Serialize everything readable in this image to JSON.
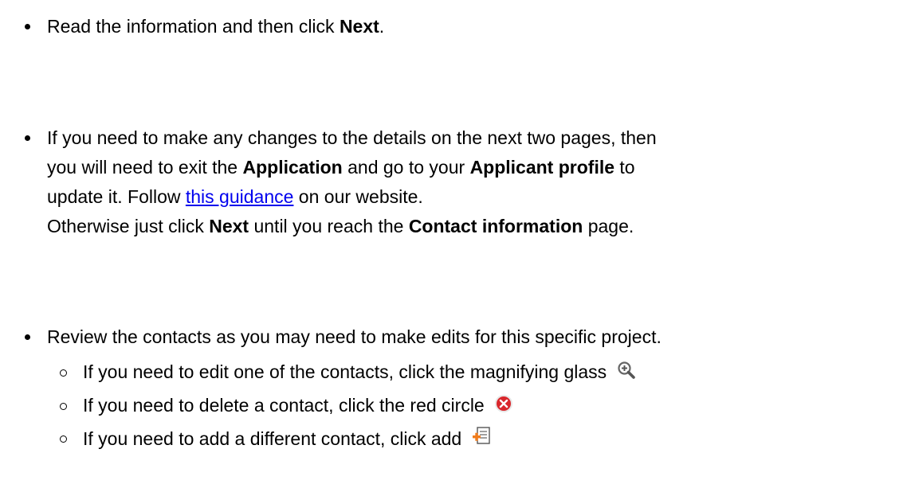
{
  "bullets": [
    {
      "lines": [
        {
          "pre": "Read the information and then click ",
          "b1": "Next",
          "post": "."
        }
      ]
    },
    {
      "line1": {
        "pre": "If you need to make any changes to the details on the next two pages, then"
      },
      "line2": {
        "pre": "you will need to exit the ",
        "b1": "Application",
        "mid": " and go to your ",
        "b2": "Applicant profile",
        "post": " to"
      },
      "line3": {
        "pre": "update it. Follow ",
        "link": "this guidance",
        "post": " on our website."
      },
      "line4": {
        "pre": "Otherwise just click ",
        "b1": "Next",
        "mid": " until you reach the ",
        "b2": "Contact information",
        "post": " page."
      }
    },
    {
      "line1": {
        "pre": "Review the contacts as you may need to make edits for this specific project."
      },
      "subitems": [
        {
          "text": "If you need to edit one of the contacts, click the magnifying glass",
          "icon": "magnifying-glass-icon"
        },
        {
          "text": "If you need to delete a contact, click the red circle",
          "icon": "red-circle-x-icon"
        },
        {
          "text": "If you need to add a different contact, click add",
          "icon": "add-document-icon"
        }
      ]
    }
  ],
  "colors": {
    "link": "#0000ee",
    "delete_red": "#d9262b",
    "add_orange": "#f07c1c"
  }
}
